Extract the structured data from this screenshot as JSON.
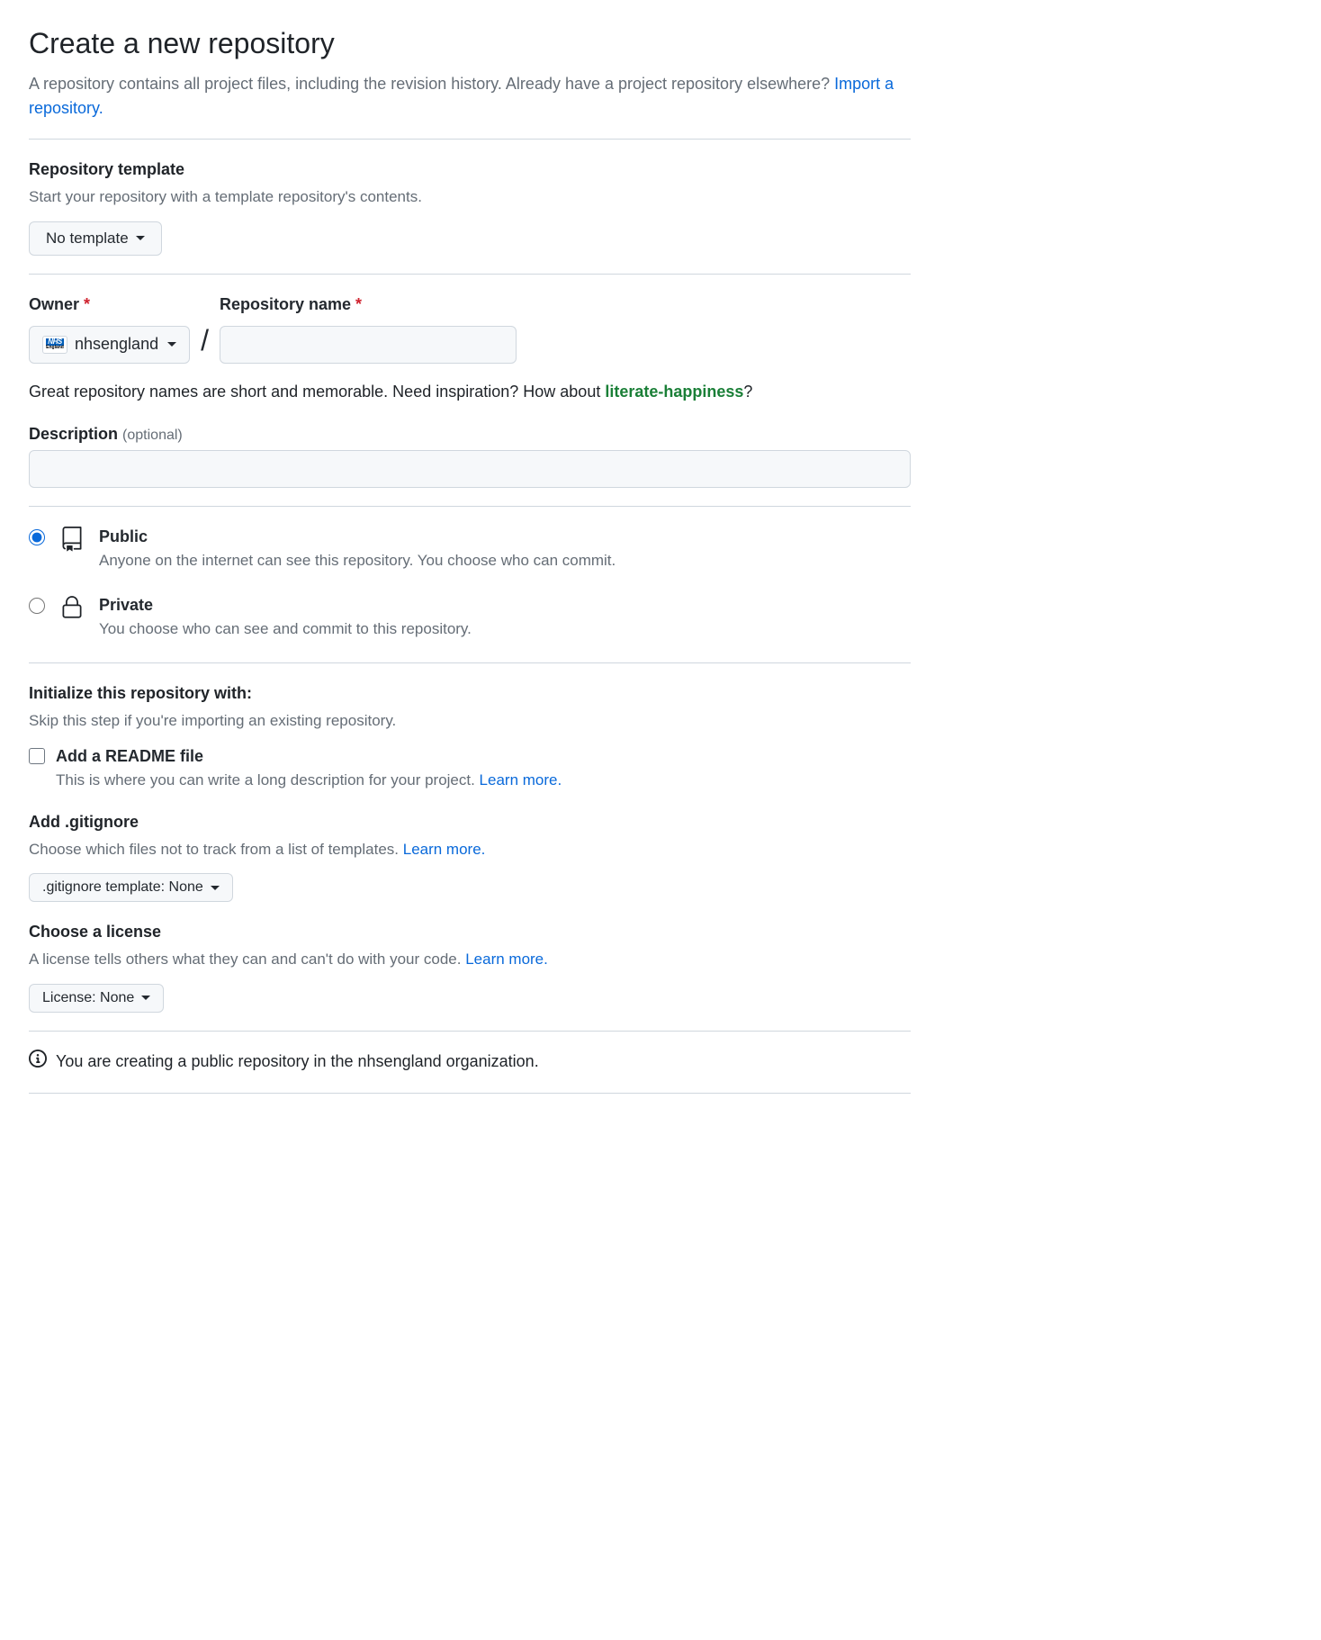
{
  "header": {
    "title": "Create a new repository",
    "subtitle_text": "A repository contains all project files, including the revision history. Already have a project repository elsewhere? ",
    "import_link": "Import a repository."
  },
  "template": {
    "label": "Repository template",
    "desc": "Start your repository with a template repository's contents.",
    "button": "No template"
  },
  "owner": {
    "label": "Owner",
    "selected": "nhsengland"
  },
  "repo_name": {
    "label": "Repository name"
  },
  "hint": {
    "prefix": "Great repository names are short and memorable. Need inspiration? How about ",
    "suggestion": "literate-happiness",
    "suffix": "?"
  },
  "description": {
    "label": "Description",
    "optional": "(optional)"
  },
  "visibility": {
    "public": {
      "title": "Public",
      "desc": "Anyone on the internet can see this repository. You choose who can commit."
    },
    "private": {
      "title": "Private",
      "desc": "You choose who can see and commit to this repository."
    }
  },
  "initialize": {
    "heading": "Initialize this repository with:",
    "subheading": "Skip this step if you're importing an existing repository.",
    "readme": {
      "title": "Add a README file",
      "desc": "This is where you can write a long description for your project. ",
      "link": "Learn more."
    },
    "gitignore": {
      "title": "Add .gitignore",
      "desc": "Choose which files not to track from a list of templates. ",
      "link": "Learn more.",
      "button": ".gitignore template: None"
    },
    "license": {
      "title": "Choose a license",
      "desc": "A license tells others what they can and can't do with your code. ",
      "link": "Learn more.",
      "button": "License: None"
    }
  },
  "info_notice": "You are creating a public repository in the nhsengland organization."
}
